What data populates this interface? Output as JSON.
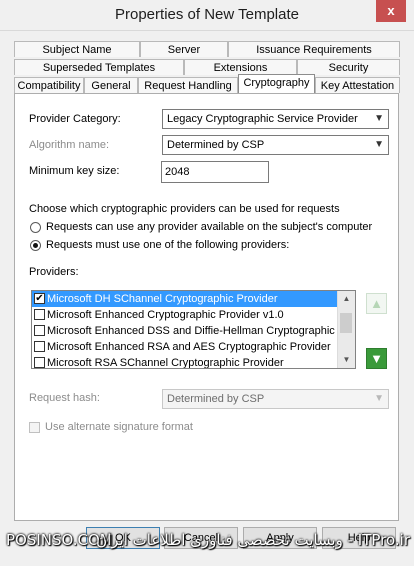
{
  "window": {
    "title": "Properties of New Template",
    "close_glyph": "x"
  },
  "tabs": {
    "row1": [
      "Subject Name",
      "Server",
      "Issuance Requirements"
    ],
    "row2": [
      "Superseded Templates",
      "Extensions",
      "Security"
    ],
    "row3": [
      "Compatibility",
      "General",
      "Request Handling",
      "Cryptography",
      "Key Attestation"
    ],
    "active": "Cryptography"
  },
  "form": {
    "provider_category_label": "Provider Category:",
    "provider_category_value": "Legacy Cryptographic Service Provider",
    "algorithm_label": "Algorithm name:",
    "algorithm_value": "Determined by CSP",
    "min_key_label": "Minimum key size:",
    "min_key_value": "2048",
    "choose_text": "Choose which cryptographic providers can be used for requests",
    "radio_any": "Requests can use any provider available on the subject's computer",
    "radio_following": "Requests must use one of the following providers:",
    "radio_selected": "following",
    "providers_label": "Providers:",
    "providers": [
      {
        "label": "Microsoft DH SChannel Cryptographic Provider",
        "checked": true,
        "selected": true
      },
      {
        "label": "Microsoft Enhanced Cryptographic Provider v1.0",
        "checked": false,
        "selected": false
      },
      {
        "label": "Microsoft Enhanced DSS and Diffie-Hellman Cryptographic Pr",
        "checked": false,
        "selected": false
      },
      {
        "label": "Microsoft Enhanced RSA and AES Cryptographic Provider",
        "checked": false,
        "selected": false
      },
      {
        "label": "Microsoft RSA SChannel Cryptographic Provider",
        "checked": false,
        "selected": false
      }
    ],
    "request_hash_label": "Request hash:",
    "request_hash_value": "Determined by CSP",
    "alt_signature_label": "Use alternate signature format"
  },
  "buttons": {
    "ok": "OK",
    "cancel": "Cancel",
    "apply": "Apply",
    "help": "Help"
  },
  "watermark": {
    "left": "POSINSO.COM",
    "right": "ITPro.ir - وبسایت تخصصی فناوری اطلاعات ایران"
  },
  "colors": {
    "selection": "#3399ff",
    "move_arrow": "#3a9a3a",
    "close_button": "#c75050"
  }
}
